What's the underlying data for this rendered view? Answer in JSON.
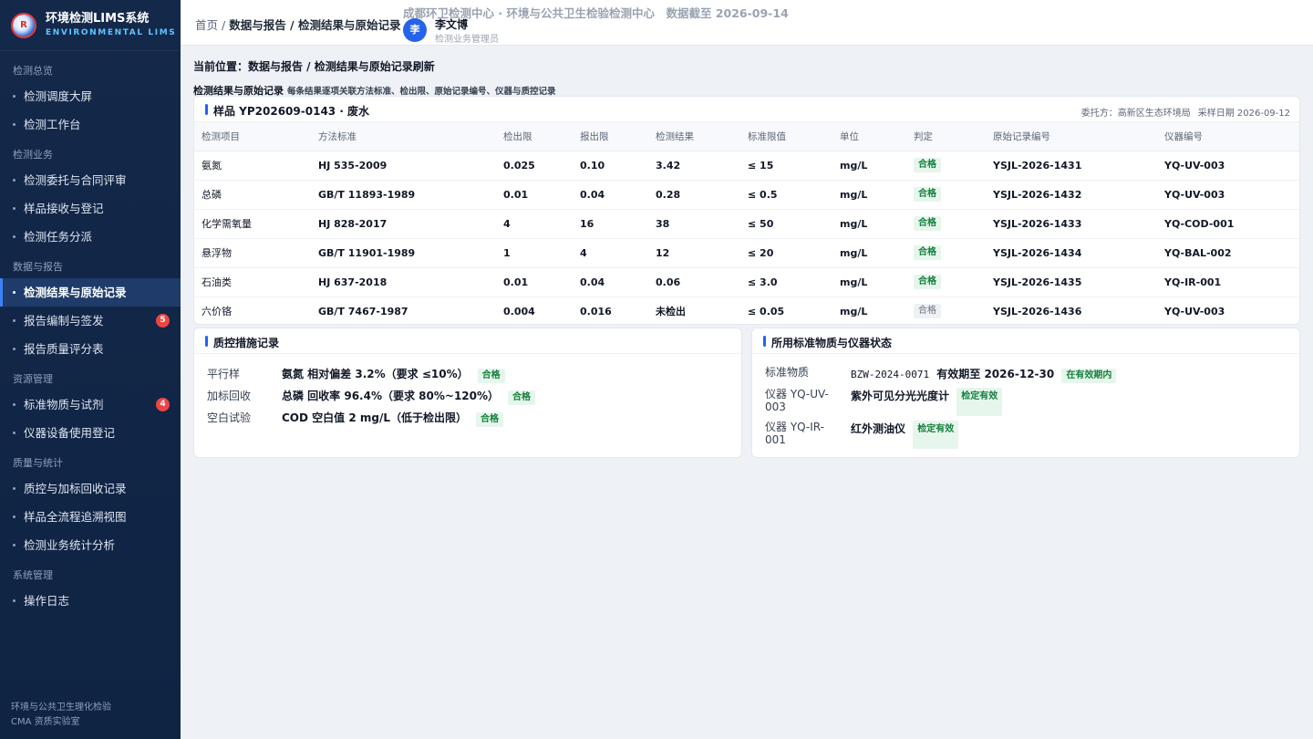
{
  "app": {
    "title": "环境检测LIMS系统",
    "subtitle": "ENVIRONMENTAL LIMS",
    "footer_line1": "环境与公共卫生理化检验",
    "footer_line2": "CMA 资质实验室"
  },
  "sidebar": {
    "groups": [
      {
        "label": "检测总览",
        "items": [
          {
            "label": "检测调度大屏"
          },
          {
            "label": "检测工作台"
          }
        ]
      },
      {
        "label": "检测业务",
        "items": [
          {
            "label": "检测委托与合同评审"
          },
          {
            "label": "样品接收与登记"
          },
          {
            "label": "检测任务分派"
          }
        ]
      },
      {
        "label": "数据与报告",
        "items": [
          {
            "label": "检测结果与原始记录",
            "active": true
          },
          {
            "label": "报告编制与签发",
            "badge": "5"
          },
          {
            "label": "报告质量评分表"
          }
        ]
      },
      {
        "label": "资源管理",
        "items": [
          {
            "label": "标准物质与试剂",
            "badge": "4"
          },
          {
            "label": "仪器设备使用登记"
          }
        ]
      },
      {
        "label": "质量与统计",
        "items": [
          {
            "label": "质控与加标回收记录"
          },
          {
            "label": "样品全流程追溯视图"
          },
          {
            "label": "检测业务统计分析"
          }
        ]
      },
      {
        "label": "系统管理",
        "items": [
          {
            "label": "操作日志"
          }
        ]
      }
    ]
  },
  "topbar": {
    "crumb_home": "首页",
    "crumb_sep": " / ",
    "crumb_path": "数据与报告 / 检测结果与原始记录",
    "org": "成都环卫检测中心 · 环境与公共卫生检验检测中心　数据截至 2026-09-14",
    "avatar": "李",
    "user_name": "李文博",
    "user_role": "检测业务管理员"
  },
  "location": "当前位置：数据与报告 / 检测结果与原始记录刷新",
  "section": {
    "title": "检测结果与原始记录",
    "desc": "每条结果逐项关联方法标准、检出限、原始记录编号、仪器与质控记录"
  },
  "sample": {
    "title": "样品 YP202609-0143 · 废水",
    "client": "委托方：高新区生态环境局",
    "date": "采样日期 2026-09-12",
    "columns": [
      "检测项目",
      "方法标准",
      "检出限",
      "报出限",
      "检测结果",
      "标准限值",
      "单位",
      "判定",
      "原始记录编号",
      "仪器编号"
    ],
    "rows": [
      {
        "item": "氨氮",
        "method": "HJ 535-2009",
        "lod": "0.025",
        "loq": "0.10",
        "result": "3.42",
        "limit": "≤ 15",
        "unit": "mg/L",
        "verdict": "合格",
        "record": "YSJL-2026-1431",
        "inst": "YQ-UV-003"
      },
      {
        "item": "总磷",
        "method": "GB/T 11893-1989",
        "lod": "0.01",
        "loq": "0.04",
        "result": "0.28",
        "limit": "≤ 0.5",
        "unit": "mg/L",
        "verdict": "合格",
        "record": "YSJL-2026-1432",
        "inst": "YQ-UV-003"
      },
      {
        "item": "化学需氧量",
        "method": "HJ 828-2017",
        "lod": "4",
        "loq": "16",
        "result": "38",
        "limit": "≤ 50",
        "unit": "mg/L",
        "verdict": "合格",
        "record": "YSJL-2026-1433",
        "inst": "YQ-COD-001"
      },
      {
        "item": "悬浮物",
        "method": "GB/T 11901-1989",
        "lod": "1",
        "loq": "4",
        "result": "12",
        "limit": "≤ 20",
        "unit": "mg/L",
        "verdict": "合格",
        "record": "YSJL-2026-1434",
        "inst": "YQ-BAL-002"
      },
      {
        "item": "石油类",
        "method": "HJ 637-2018",
        "lod": "0.01",
        "loq": "0.04",
        "result": "0.06",
        "limit": "≤ 3.0",
        "unit": "mg/L",
        "verdict": "合格",
        "record": "YSJL-2026-1435",
        "inst": "YQ-IR-001"
      },
      {
        "item": "六价铬",
        "method": "GB/T 7467-1987",
        "lod": "0.004",
        "loq": "0.016",
        "result": "未检出",
        "limit": "≤ 0.05",
        "unit": "mg/L",
        "verdict": "合格",
        "verdict_style": "gray",
        "record": "YSJL-2026-1436",
        "inst": "YQ-UV-003"
      }
    ]
  },
  "qc": {
    "title": "质控措施记录",
    "rows": [
      {
        "label": "平行样",
        "value": "氨氮 相对偏差 3.2%（要求 ≤10%）",
        "tag": "合格"
      },
      {
        "label": "加标回收",
        "value": "总磷 回收率 96.4%（要求 80%~120%）",
        "tag": "合格"
      },
      {
        "label": "空白试验",
        "value": "COD 空白值 2 mg/L（低于检出限）",
        "tag": "合格"
      }
    ]
  },
  "standards": {
    "title": "所用标准物质与仪器状态",
    "ref_label": "标准物质",
    "ref_code": "BZW-2024-0071",
    "ref_expiry": "有效期至 2026-12-30",
    "ref_tag": "在有效期内",
    "inst1_label": "仪器 YQ-UV-003",
    "inst1_name": "紫外可见分光光度计",
    "inst1_tag": "检定有效",
    "inst2_label": "仪器 YQ-IR-001",
    "inst2_name": "红外测油仪",
    "inst2_tag": "检定有效"
  }
}
